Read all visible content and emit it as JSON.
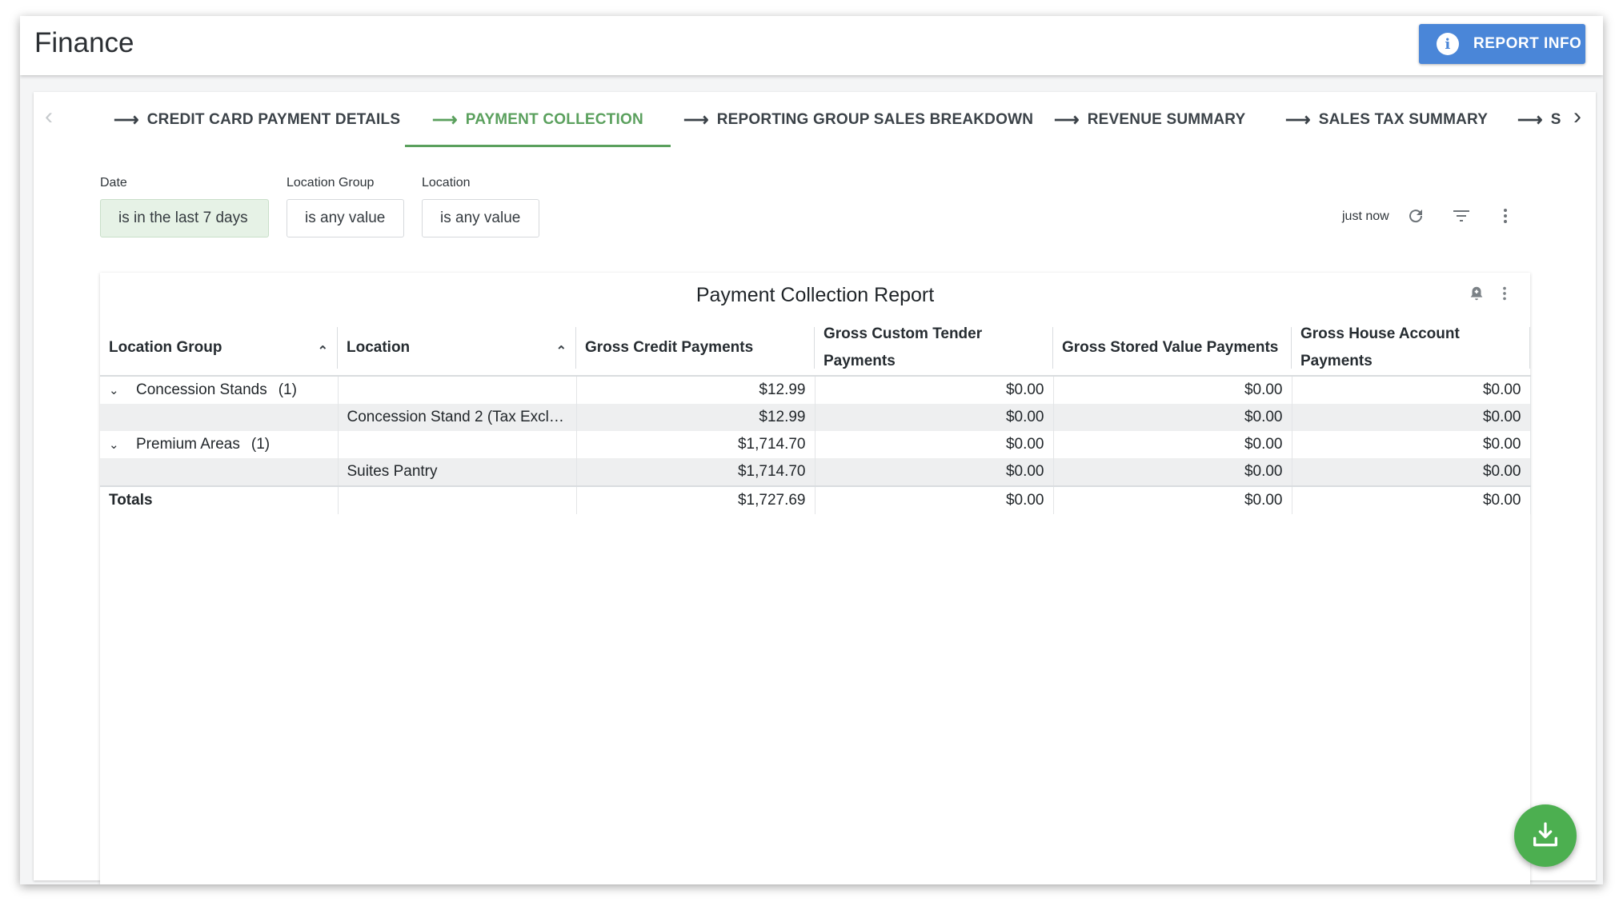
{
  "app": {
    "title": "Finance",
    "report_info_label": "REPORT INFO"
  },
  "tabs": [
    {
      "label": "CREDIT CARD PAYMENT DETAILS",
      "active": false
    },
    {
      "label": "PAYMENT COLLECTION",
      "active": true
    },
    {
      "label": "REPORTING GROUP SALES BREAKDOWN",
      "active": false
    },
    {
      "label": "REVENUE SUMMARY",
      "active": false
    },
    {
      "label": "SALES TAX SUMMARY",
      "active": false
    },
    {
      "label": "STC",
      "active": false
    }
  ],
  "filters": [
    {
      "label": "Date",
      "value": "is in the last 7 days",
      "active": true
    },
    {
      "label": "Location Group",
      "value": "is any value",
      "active": false
    },
    {
      "label": "Location",
      "value": "is any value",
      "active": false
    }
  ],
  "toolbar": {
    "last_updated": "just now",
    "icons": [
      "refresh-icon",
      "filter-icon",
      "more-vert-icon"
    ]
  },
  "report": {
    "title": "Payment Collection Report",
    "columns": [
      "Location Group",
      "Location",
      "Gross Credit Payments",
      "Gross Custom Tender Payments",
      "Gross Stored Value Payments",
      "Gross House Account Payments"
    ],
    "rows": [
      {
        "group": "Concession Stands",
        "count": "(1)",
        "location": "",
        "values": [
          "$12.99",
          "$0.00",
          "$0.00",
          "$0.00"
        ]
      },
      {
        "group": "",
        "count": "",
        "location": "Concession Stand 2 (Tax Excl…",
        "values": [
          "$12.99",
          "$0.00",
          "$0.00",
          "$0.00"
        ]
      },
      {
        "group": "Premium Areas",
        "count": "(1)",
        "location": "",
        "values": [
          "$1,714.70",
          "$0.00",
          "$0.00",
          "$0.00"
        ]
      },
      {
        "group": "",
        "count": "",
        "location": "Suites Pantry",
        "values": [
          "$1,714.70",
          "$0.00",
          "$0.00",
          "$0.00"
        ]
      }
    ],
    "totals": {
      "label": "Totals",
      "values": [
        "$1,727.69",
        "$0.00",
        "$0.00",
        "$0.00"
      ]
    }
  },
  "colors": {
    "accent_green": "#5aa05d",
    "button_blue": "#4a86d8",
    "fab_green": "#4caf50"
  }
}
